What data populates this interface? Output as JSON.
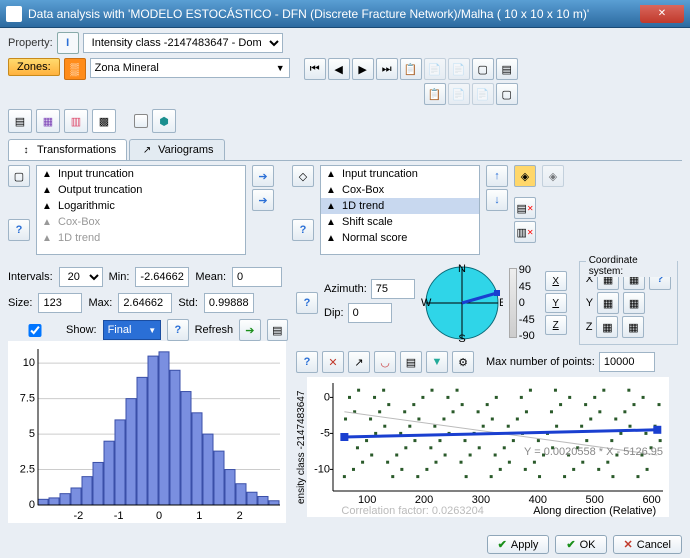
{
  "window": {
    "title": "Data analysis with 'MODELO ESTOCÁSTICO - DFN (Discrete Fracture Network)/Malha ( 10 x 10 x 10 m)'",
    "close": "✕"
  },
  "property": {
    "label": "Property:",
    "value": "Intensity class -2147483647 - Dom"
  },
  "zones": {
    "label": "Zones:",
    "value": "Zona Mineral"
  },
  "nav": {
    "first": "⏮",
    "prev": "◀",
    "next": "▶",
    "last": "⏭"
  },
  "tabs": {
    "transform": "Transformations",
    "variograms": "Variograms"
  },
  "left_list": {
    "items": [
      {
        "label": "Input truncation",
        "muted": false
      },
      {
        "label": "Output truncation",
        "muted": false
      },
      {
        "label": "Logarithmic",
        "muted": false
      },
      {
        "label": "Cox-Box",
        "muted": true
      },
      {
        "label": "1D trend",
        "muted": true
      }
    ]
  },
  "right_list": {
    "items": [
      {
        "label": "Input truncation",
        "sel": false
      },
      {
        "label": "Cox-Box",
        "sel": false
      },
      {
        "label": "1D trend",
        "sel": true
      },
      {
        "label": "Shift scale",
        "sel": false
      },
      {
        "label": "Normal score",
        "sel": false
      }
    ]
  },
  "stats": {
    "intervals_label": "Intervals:",
    "intervals": "20",
    "min_label": "Min:",
    "min": "-2.64662",
    "mean_label": "Mean:",
    "mean": "0",
    "size_label": "Size:",
    "size": "123",
    "max_label": "Max:",
    "max": "2.64662",
    "std_label": "Std:",
    "std": "0.99888",
    "show_label": "Show:",
    "show_value": "Final",
    "refresh": "Refresh"
  },
  "compass": {
    "azimuth_label": "Azimuth:",
    "azimuth": "75",
    "dip_label": "Dip:",
    "dip": "0",
    "n": "N",
    "s": "S",
    "e": "E",
    "w": "W",
    "scale": {
      "t90": "90",
      "t45": "45",
      "t0": "0",
      "tm45": "-45",
      "tm90": "-90"
    }
  },
  "coord": {
    "title": "Coordinate system:",
    "x": "X",
    "y": "Y",
    "z": "Z",
    "xb": "X",
    "yb": "Y",
    "zb": "Z"
  },
  "scatter": {
    "maxpts_label": "Max number of points:",
    "maxpts": "10000",
    "ylabel": "ensity class -2147483647",
    "xlabel": "Along direction (Relative)",
    "eq": "Y = 0.0020558 * X - 5126.95",
    "corr": "Correlation factor: 0.0263204",
    "xticks": [
      "100",
      "200",
      "300",
      "400",
      "500",
      "600"
    ],
    "yticks": [
      "-10",
      "-5",
      "0"
    ]
  },
  "chart_data": {
    "type": "bar",
    "title": "",
    "xlabel": "",
    "ylabel": "",
    "categories": [
      "-2.75",
      "-2.5",
      "-2.25",
      "-2",
      "-1.75",
      "-1.5",
      "-1.25",
      "-1",
      "-0.75",
      "-0.5",
      "-0.25",
      "0",
      "0.25",
      "0.5",
      "0.75",
      "1",
      "1.25",
      "1.5",
      "1.75",
      "2",
      "2.25",
      "2.5"
    ],
    "values": [
      0.4,
      0.5,
      0.8,
      1.2,
      2.0,
      3.0,
      4.5,
      6.0,
      7.5,
      9.0,
      10.5,
      10.8,
      9.5,
      8.0,
      6.5,
      5.0,
      3.8,
      2.5,
      1.5,
      0.9,
      0.6,
      0.3
    ],
    "xlim": [
      -3,
      3
    ],
    "ylim": [
      0,
      11
    ],
    "xticks": [
      -2,
      -1,
      0,
      1,
      2
    ],
    "yticks": [
      0,
      2.5,
      5,
      7.5,
      10
    ]
  },
  "footer": {
    "apply": "Apply",
    "ok": "OK",
    "cancel": "Cancel"
  }
}
